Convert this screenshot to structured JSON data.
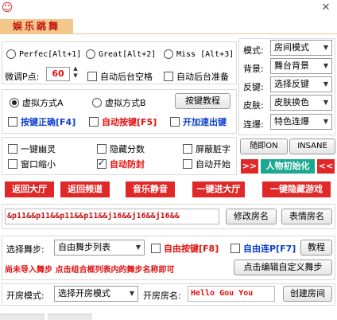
{
  "window": {
    "icon_glyph": "☺",
    "close_glyph": "✕",
    "brand_label": "娱乐跳舞"
  },
  "modes": {
    "perfect": "Perfec[Alt+1]",
    "great": "Great[Alt+2]",
    "miss": "Miss [Alt+3]",
    "fine_label": "微调P点:",
    "fine_value": "60",
    "auto_space": "自动后台空格",
    "auto_ready": "自动后台准备"
  },
  "right_panel": {
    "mode_label": "模式:",
    "mode_value": "房间模式",
    "bg_label": "背景:",
    "bg_value": "舞台背景",
    "key_label": "反键:",
    "key_value": "选择反键",
    "skin_label": "皮肤:",
    "skin_value": "皮肤换色",
    "combo_label": "连爆:",
    "combo_value": "特色连爆"
  },
  "virtual": {
    "mode_a": "虚拟方式A",
    "mode_b": "虚拟方式B",
    "tutorial": "按键教程",
    "correct_key": "按键正确[F4]",
    "auto_key": "自动按键[F5]",
    "speed_key": "开加速出键"
  },
  "options": {
    "ghost": "一键幽灵",
    "hide_score": "隐藏分数",
    "mask_words": "屏蔽脏字",
    "shrink": "窗口缩小",
    "auto_protect": "自动防封",
    "auto_start": "自动开始",
    "random_on": "随即ON",
    "insane": "INSANE",
    "arrows": ">>",
    "init_char": "人物初始化",
    "arrows2": "<<"
  },
  "actions": {
    "back_hall": "返回大厅",
    "back_channel": "返回频道",
    "music_mute": "音乐静音",
    "one_key_hall": "一键进大厅",
    "one_key_hide": "一键隐藏游戏"
  },
  "room": {
    "name_text": "&p11&&p11&&p11&&p11&&j16&&j16&&j16&&",
    "modify_button": "修改房名",
    "emoji_button": "表情房名"
  },
  "dance": {
    "select_label": "选择舞步:",
    "select_value": "自由舞步列表",
    "free_key": "自由按键[F8]",
    "free_combo": "自由连P[F7]",
    "tutorial": "教程",
    "notice": "尚未导入舞步 点击组合框列表内的舞步名称即可",
    "edit_button": "点击编辑自定义舞步"
  },
  "open_room": {
    "mode_label": "开房模式:",
    "mode_value": "选择开房模式",
    "name_label": "开房房名:",
    "name_value": "Hello Gou You",
    "create_button": "创建房间"
  },
  "colors": {
    "accent_red": "#e02828",
    "teal": "#1aa890",
    "link_blue": "#1040d0"
  }
}
